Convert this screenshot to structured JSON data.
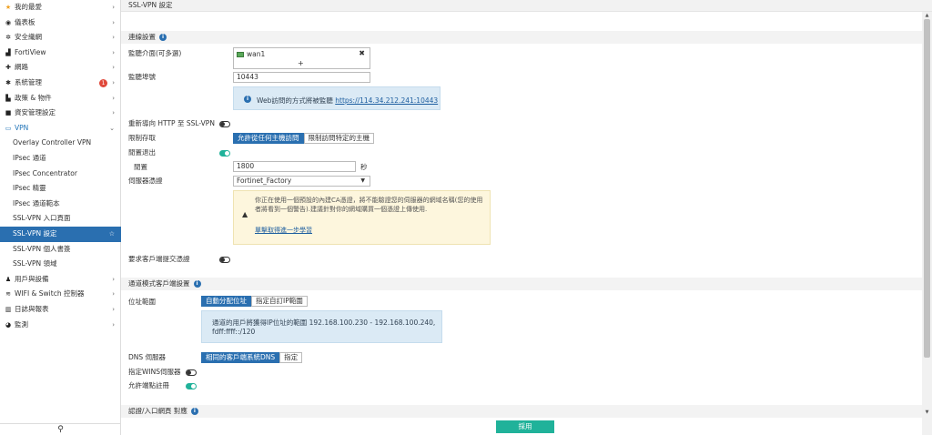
{
  "sidebar": {
    "items": [
      {
        "icon": "star-icon",
        "glyph": "★",
        "label": "我的最愛"
      },
      {
        "icon": "dashboard-icon",
        "glyph": "◉",
        "label": "儀表板"
      },
      {
        "icon": "security-fabric-icon",
        "glyph": "✲",
        "label": "安全織網"
      },
      {
        "icon": "fortiview-icon",
        "glyph": "▟",
        "label": "FortiView"
      },
      {
        "icon": "network-icon",
        "glyph": "✚",
        "label": "網路"
      },
      {
        "icon": "gear-icon",
        "glyph": "✱",
        "label": "系統管理",
        "badge": "1"
      },
      {
        "icon": "policy-icon",
        "glyph": "▙",
        "label": "政策 & 物件"
      },
      {
        "icon": "lock-icon",
        "glyph": "■",
        "label": "資安管理設定"
      },
      {
        "icon": "vpn-monitor-icon",
        "glyph": "▭",
        "label": "VPN"
      },
      {
        "label": "Overlay Controller VPN"
      },
      {
        "label": "IPsec 通道"
      },
      {
        "label": "IPsec Concentrator"
      },
      {
        "label": "IPsec 精靈"
      },
      {
        "label": "IPsec 通道範本"
      },
      {
        "label": "SSL-VPN 入口頁面"
      },
      {
        "label": "SSL-VPN 設定"
      },
      {
        "label": "SSL-VPN 個人書簽"
      },
      {
        "label": "SSL-VPN 領域"
      },
      {
        "icon": "user-icon",
        "glyph": "♟",
        "label": "用戶與設備"
      },
      {
        "icon": "wifi-icon",
        "glyph": "≋",
        "label": "WIFI & Switch 控制器"
      },
      {
        "icon": "log-report-icon",
        "glyph": "▥",
        "label": "日誌與報表"
      },
      {
        "icon": "monitor-icon",
        "glyph": "◕",
        "label": "監測"
      }
    ],
    "search_icon": "search-icon",
    "search_glyph": "⚲"
  },
  "page_title": "SSL-VPN 設定",
  "connection": {
    "section_title": "連線設置",
    "listen_iface_label": "監聽介面(可多選)",
    "iface_name": "wan1",
    "iface_add": "+",
    "iface_remove": "✖",
    "listen_port_label": "監聽埠號",
    "listen_port_value": "10443",
    "web_access_text": "Web訪問的方式將被監聽",
    "web_access_link": "https://114.34.212.241:10443",
    "redirect_label": "重新導向 HTTP 至 SSL-VPN",
    "restrict_label": "限制存取",
    "restrict_opt_all": "允許從任何主機訪問",
    "restrict_opt_specific": "限制訪問特定的主機",
    "idle_logout_label": "閒置退出",
    "idle_label": "閒置",
    "idle_value": "1800",
    "idle_unit": "秒",
    "server_cert_label": "伺服器憑證",
    "server_cert_value": "Fortinet_Factory",
    "cert_warning": "你正在使用一個預設的內建CA憑證，將不能驗證您的伺服器的網域名稱(您的使用者將看到一個警告).建議針對你的網域購買一個憑證上傳使用.",
    "cert_warning_link": "單擊取得進一步學習",
    "client_cert_label": "要求客戶端提交憑證"
  },
  "tunnel": {
    "section_title": "通道模式客戶端設置",
    "address_range_label": "位址範圍",
    "addr_opt_auto": "自動分配位址",
    "addr_opt_custom": "指定自訂IP範圍",
    "addr_info": "通道的用戶將獲得IP位址的範圍 192.168.100.230 - 192.168.100.240, fdff:ffff::/120",
    "dns_label": "DNS 伺服器",
    "dns_opt_same": "相同的客戶端系統DNS",
    "dns_opt_specify": "指定",
    "wins_label": "指定WINS伺服器",
    "endpoint_label": "允許端點註冊"
  },
  "auth_section_title": "認證/入口網頁 對應",
  "apply_label": "採用",
  "colors": {
    "accent": "#2a6fb0",
    "apply": "#20b29a",
    "badge": "#e0483a"
  }
}
